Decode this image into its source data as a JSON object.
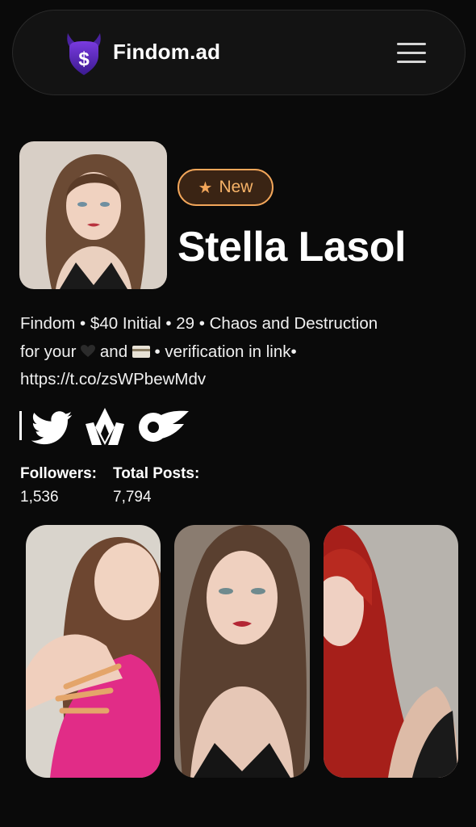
{
  "header": {
    "brand": "Findom.ad",
    "logo_icon": "devil-dollar-icon",
    "menu_icon": "hamburger-menu-icon"
  },
  "profile": {
    "badge": "New",
    "badge_icon": "star-icon",
    "name": "Stella Lasol",
    "bio_line1": "Findom • $40 Initial • 29 •  Chaos and Destruction",
    "bio_line2_a": "for your",
    "bio_line2_b": "and",
    "bio_line2_c": "• verification in link•",
    "bio_line3": "https://t.co/zsWPbewMdv",
    "bio_emojis": [
      "black-heart-emoji",
      "credit-card-emoji"
    ]
  },
  "socials": [
    "twitter-icon",
    "loyalfans-icon",
    "onlyfans-icon"
  ],
  "stats": {
    "followers_label": "Followers:",
    "followers_value": "1,536",
    "posts_label": "Total Posts:",
    "posts_value": "7,794"
  },
  "colors": {
    "background": "#0a0a0a",
    "accent": "#f2a65a",
    "logo": "#5b2bb5"
  }
}
